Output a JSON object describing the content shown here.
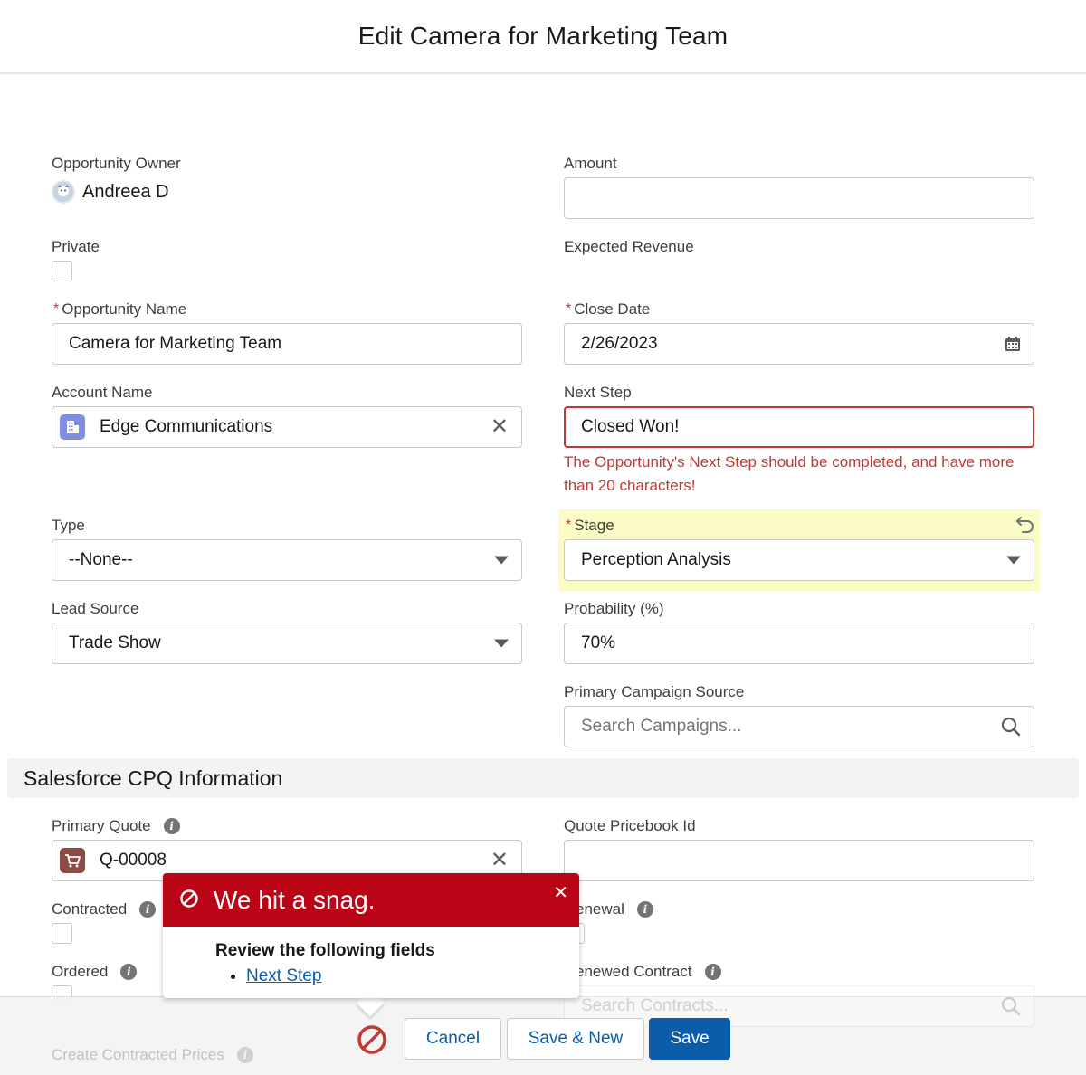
{
  "modal": {
    "title": "Edit Camera for Marketing Team"
  },
  "left": {
    "owner_label": "Opportunity Owner",
    "owner_name": "Andreea D",
    "private_label": "Private",
    "opp_name_label": "Opportunity Name",
    "opp_name_value": "Camera for Marketing Team",
    "account_label": "Account Name",
    "account_value": "Edge Communications",
    "type_label": "Type",
    "type_value": "--None--",
    "lead_label": "Lead Source",
    "lead_value": "Trade Show"
  },
  "right": {
    "amount_label": "Amount",
    "amount_value": "",
    "expected_label": "Expected Revenue",
    "close_label": "Close Date",
    "close_value": "2/26/2023",
    "next_step_label": "Next Step",
    "next_step_value": "Closed Won!",
    "next_step_error": "The Opportunity's Next Step should be completed, and have more than 20 characters!",
    "stage_label": "Stage",
    "stage_value": "Perception Analysis",
    "prob_label": "Probability (%)",
    "prob_value": "70%",
    "campaign_label": "Primary Campaign Source",
    "campaign_placeholder": "Search Campaigns..."
  },
  "section": {
    "title": "Salesforce CPQ Information",
    "primary_quote_label": "Primary Quote",
    "primary_quote_value": "Q-00008",
    "pricebook_label": "Quote Pricebook Id",
    "contracted_label": "Contracted",
    "renewal_label": "enewal",
    "ordered_label": "Ordered",
    "renewed_contract_label": "enewed Contract",
    "renewed_contract_placeholder": "Search Contracts...",
    "create_prices_label": "Create Contracted Prices"
  },
  "popover": {
    "heading": "We hit a snag.",
    "subtitle": "Review the following fields",
    "fields": [
      "Next Step"
    ]
  },
  "footer": {
    "cancel": "Cancel",
    "save_new": "Save & New",
    "save": "Save"
  },
  "colors": {
    "brand": "#0b5cab",
    "error": "#c23934",
    "popover_header": "#ba0517",
    "highlight": "#fbfbc5"
  }
}
